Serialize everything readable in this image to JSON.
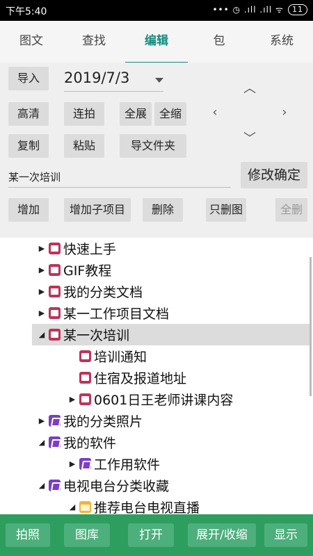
{
  "status": {
    "time": "下午5:40",
    "battery": "11",
    "icons": "••• ◷ .ıll .ıll ᯤ"
  },
  "tabs": [
    "图文",
    "查找",
    "编辑",
    "包",
    "系统"
  ],
  "editor": {
    "import": "导入",
    "date": "2019/7/3",
    "hd": "高清",
    "burst": "连拍",
    "expand_all": "全展",
    "collapse_all": "全缩",
    "copy": "复制",
    "paste": "粘贴",
    "import_folder": "导文件夹",
    "name_value": "某一次培训",
    "confirm": "修改确定",
    "add": "增加",
    "add_child": "增加子项目",
    "delete": "删除",
    "delete_image_only": "只删图",
    "delete_all": "全删"
  },
  "tree": [
    {
      "label": "快速上手",
      "icon": "doc-icon",
      "toggle": "collapsed"
    },
    {
      "label": "GIF教程",
      "icon": "doc-icon",
      "toggle": "collapsed"
    },
    {
      "label": "我的分类文档",
      "icon": "doc-icon",
      "toggle": "collapsed"
    },
    {
      "label": "某一工作项目文档",
      "icon": "doc-icon",
      "toggle": "collapsed"
    },
    {
      "label": "某一次培训",
      "icon": "doc-icon",
      "toggle": "expanded",
      "selected": true
    },
    {
      "label": "培训通知",
      "icon": "doc-icon",
      "toggle": "none"
    },
    {
      "label": "住宿及报道地址",
      "icon": "doc-icon",
      "toggle": "none"
    },
    {
      "label": "0601日王老师讲课内容",
      "icon": "doc-icon",
      "toggle": "collapsed"
    },
    {
      "label": "我的分类照片",
      "icon": "photo-icon",
      "toggle": "collapsed"
    },
    {
      "label": "我的软件",
      "icon": "photo-icon",
      "toggle": "expanded"
    },
    {
      "label": "工作用软件",
      "icon": "photo-icon",
      "toggle": "collapsed"
    },
    {
      "label": "电视电台分类收藏",
      "icon": "photo-icon",
      "toggle": "expanded"
    },
    {
      "label": "推荐电台电视直播",
      "icon": "folder-icon",
      "toggle": "expanded"
    }
  ],
  "bottom": {
    "photo": "拍照",
    "gallery": "图库",
    "open": "打开",
    "expand_collapse": "展开/收缩",
    "show": "显示"
  },
  "colors": {
    "accent": "#128c7e",
    "bottom_bar": "#2e9e5f",
    "doc_icon": "#c0325a",
    "photo_icon": "#7b3fc4"
  }
}
